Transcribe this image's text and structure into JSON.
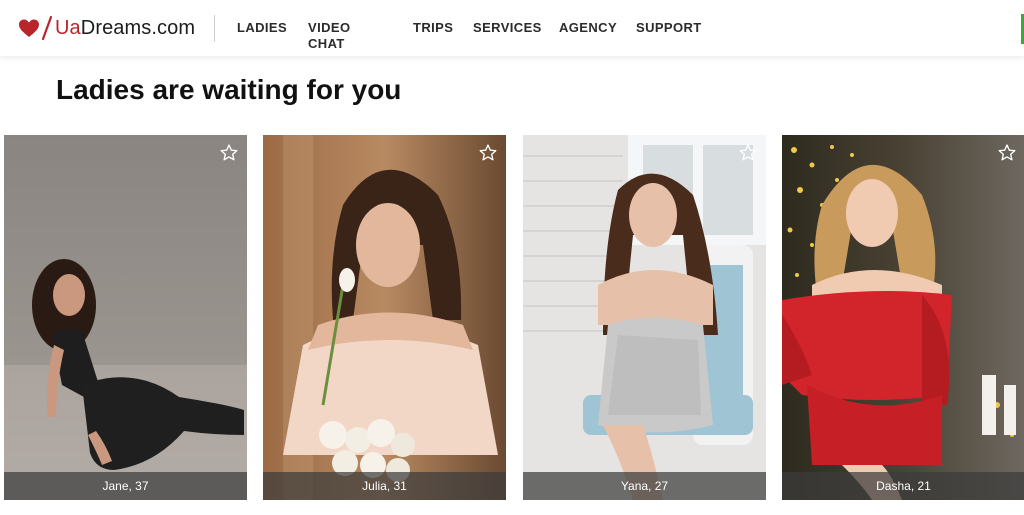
{
  "header": {
    "logo": {
      "part_ua": "Ua",
      "part_dreams": "Dreams.com",
      "brand_color": "#b8262c"
    },
    "nav": [
      {
        "label": "LADIES"
      },
      {
        "label": "VIDEO CHAT"
      },
      {
        "label": "TRIPS"
      },
      {
        "label": "SERVICES"
      },
      {
        "label": "AGENCY"
      },
      {
        "label": "SUPPORT"
      }
    ],
    "accent_color": "#3aa935"
  },
  "main": {
    "title": "Ladies are waiting for you",
    "profiles": [
      {
        "caption": "Jane, 37",
        "icon": "star-outline-icon"
      },
      {
        "caption": "Julia, 31",
        "icon": "star-outline-icon"
      },
      {
        "caption": "Yana, 27",
        "icon": "star-outline-icon"
      },
      {
        "caption": "Dasha, 21",
        "icon": "star-outline-icon"
      }
    ]
  }
}
